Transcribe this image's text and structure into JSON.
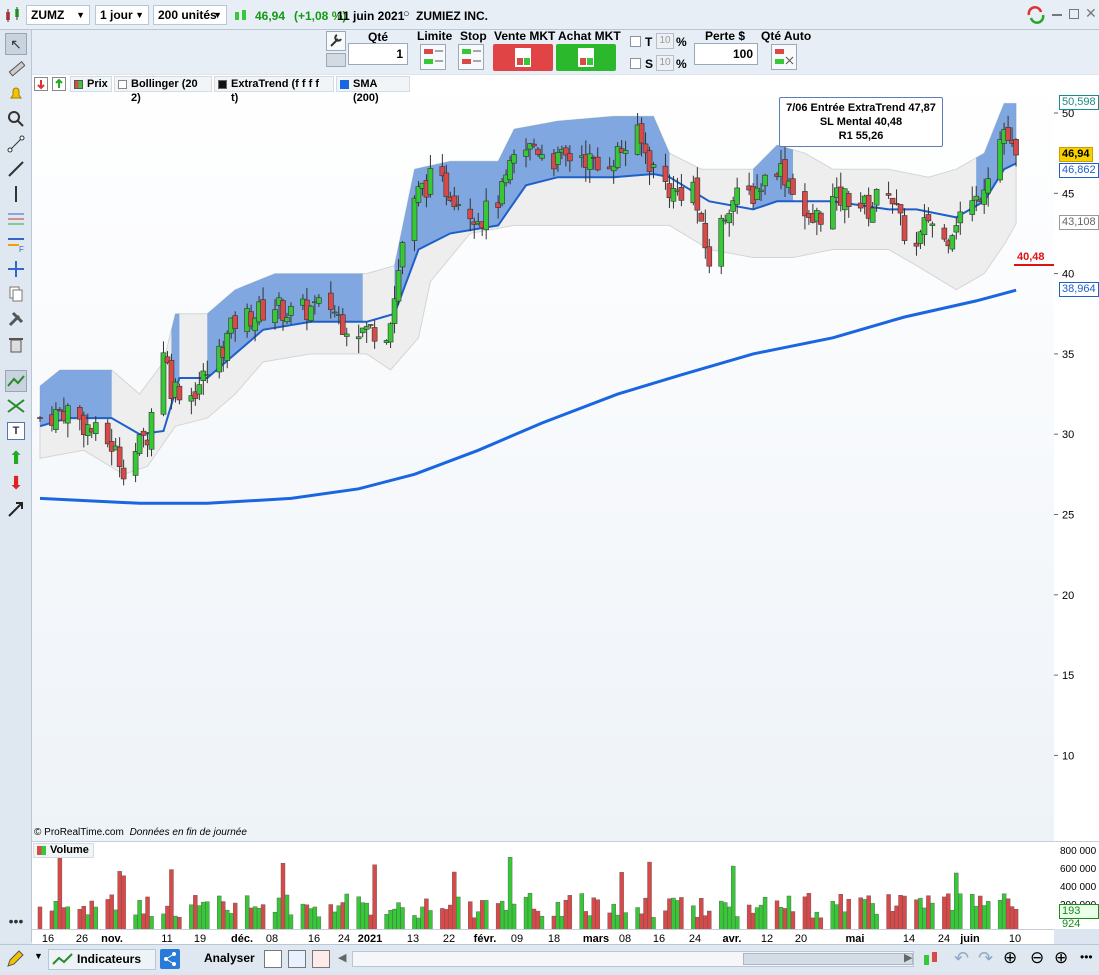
{
  "toolbar": {
    "symbol": "ZUMZ",
    "timeframe": "1 jour",
    "units": "200 unités",
    "last_price": "46,94",
    "change": "(+1,08 %)",
    "date": "11 juin 2021",
    "instrument": "ZUMIEZ INC."
  },
  "order_bar": {
    "qty_label": "Qté",
    "qty_value": "1",
    "limit_label": "Limite",
    "stop_label": "Stop",
    "sell_label": "Vente MKT",
    "buy_label": "Achat MKT",
    "t_label": "T",
    "s_label": "S",
    "pct_value": "10",
    "pct_sign": "%",
    "risk_label": "Perte $",
    "risk_value": "100",
    "auto_qty_label": "Qté Auto"
  },
  "legend": {
    "price": "Prix",
    "bollinger": "Bollinger (20 2)",
    "extratrend": "ExtraTrend (f f f f t)",
    "sma": "SMA (200)"
  },
  "annotation": {
    "line1": "7/06 Entrée ExtraTrend 47,87",
    "line2": "SL Mental 40,48",
    "line3": "R1 55,26"
  },
  "price_tags": {
    "bb_upper": "50,598",
    "last": "46,94",
    "extratrend": "46,862",
    "bb_lower": "43,108",
    "stop": "40,48",
    "sma": "38,964"
  },
  "copyright": "© ProRealTime.com",
  "data_note": "Données en fin de journée",
  "volume_panel": {
    "title": "Volume",
    "last_value": "193 924",
    "ticks": [
      "800 000",
      "600 000",
      "400 000",
      "200 000"
    ]
  },
  "bottom_bar": {
    "indicators": "Indicateurs",
    "analyze": "Analyser"
  },
  "colors": {
    "up": "#37c837",
    "down": "#d84a4a",
    "sma": "#1a66e0",
    "extratrend": "#1e5fc8",
    "bb_fill": "#eeeeee",
    "trend_fill": "#5b8fd9",
    "stop": "#dd1111"
  },
  "chart_data": {
    "type": "candlestick",
    "instrument": "ZUMZ",
    "timeframe": "daily",
    "ylim": [
      5,
      52
    ],
    "y_ticks": [
      10,
      15,
      20,
      25,
      30,
      35,
      40,
      45,
      50
    ],
    "x_tick_labels": [
      "16",
      "26",
      "nov.",
      "11",
      "19",
      "déc.",
      "08",
      "16",
      "24",
      "2021",
      "13",
      "22",
      "févr.",
      "09",
      "18",
      "mars",
      "08",
      "16",
      "24",
      "avr.",
      "12",
      "20",
      "mai",
      "14",
      "24",
      "juin",
      "10"
    ],
    "close_path": [
      [
        "2020-10-09",
        31.0
      ],
      [
        "2020-10-16",
        31.5
      ],
      [
        "2020-10-23",
        30.0
      ],
      [
        "2020-10-27",
        29.3
      ],
      [
        "2020-10-30",
        28.0
      ],
      [
        "2020-11-05",
        30.0
      ],
      [
        "2020-11-09",
        35.5
      ],
      [
        "2020-11-11",
        33.0
      ],
      [
        "2020-11-16",
        32.5
      ],
      [
        "2020-11-20",
        33.8
      ],
      [
        "2020-11-24",
        35.5
      ],
      [
        "2020-11-27",
        37.0
      ],
      [
        "2020-12-02",
        37.5
      ],
      [
        "2020-12-07",
        38.0
      ],
      [
        "2020-12-11",
        37.5
      ],
      [
        "2020-12-16",
        37.8
      ],
      [
        "2020-12-21",
        38.0
      ],
      [
        "2020-12-24",
        37.0
      ],
      [
        "2020-12-29",
        36.5
      ],
      [
        "2021-01-04",
        36.5
      ],
      [
        "2021-01-06",
        38.5
      ],
      [
        "2021-01-08",
        42.0
      ],
      [
        "2021-01-12",
        45.0
      ],
      [
        "2021-01-15",
        45.8
      ],
      [
        "2021-01-20",
        45.2
      ],
      [
        "2021-01-25",
        44.0
      ],
      [
        "2021-01-28",
        43.5
      ],
      [
        "2021-02-02",
        45.0
      ],
      [
        "2021-02-05",
        47.0
      ],
      [
        "2021-02-10",
        48.0
      ],
      [
        "2021-02-16",
        47.0
      ],
      [
        "2021-02-22",
        47.5
      ],
      [
        "2021-02-26",
        46.5
      ],
      [
        "2021-03-03",
        47.5
      ],
      [
        "2021-03-08",
        48.5
      ],
      [
        "2021-03-12",
        46.5
      ],
      [
        "2021-03-17",
        45.0
      ],
      [
        "2021-03-22",
        45.5
      ],
      [
        "2021-03-24",
        42.5
      ],
      [
        "2021-03-26",
        40.8
      ],
      [
        "2021-03-31",
        44.5
      ],
      [
        "2021-04-06",
        45.0
      ],
      [
        "2021-04-12",
        46.8
      ],
      [
        "2021-04-16",
        45.5
      ],
      [
        "2021-04-20",
        43.0
      ],
      [
        "2021-04-26",
        44.5
      ],
      [
        "2021-04-30",
        44.8
      ],
      [
        "2021-05-05",
        44.0
      ],
      [
        "2021-05-10",
        45.5
      ],
      [
        "2021-05-13",
        43.0
      ],
      [
        "2021-05-17",
        41.5
      ],
      [
        "2021-05-20",
        43.5
      ],
      [
        "2021-05-24",
        42.0
      ],
      [
        "2021-05-27",
        43.5
      ],
      [
        "2021-06-01",
        44.5
      ],
      [
        "2021-06-04",
        46.5
      ],
      [
        "2021-06-08",
        49.0
      ],
      [
        "2021-06-11",
        46.94
      ]
    ],
    "series": [
      {
        "name": "SMA (200)",
        "type": "line",
        "points": [
          [
            "2020-10-09",
            26.0
          ],
          [
            "2020-11-03",
            25.7
          ],
          [
            "2020-11-20",
            25.7
          ],
          [
            "2020-12-11",
            26.0
          ],
          [
            "2020-12-28",
            26.6
          ],
          [
            "2021-01-11",
            27.5
          ],
          [
            "2021-01-27",
            29.0
          ],
          [
            "2021-02-12",
            30.7
          ],
          [
            "2021-03-03",
            32.5
          ],
          [
            "2021-03-19",
            33.7
          ],
          [
            "2021-04-06",
            35.0
          ],
          [
            "2021-04-26",
            36.0
          ],
          [
            "2021-05-14",
            37.3
          ],
          [
            "2021-06-01",
            38.3
          ],
          [
            "2021-06-11",
            38.964
          ]
        ]
      },
      {
        "name": "Bollinger (20 2)",
        "type": "band",
        "upper": [
          [
            "2020-10-09",
            33.0
          ],
          [
            "2020-10-14",
            34.0
          ],
          [
            "2020-10-27",
            34.0
          ],
          [
            "2020-11-03",
            32.5
          ],
          [
            "2020-11-09",
            34.5
          ],
          [
            "2020-11-12",
            37.5
          ],
          [
            "2020-11-20",
            37.5
          ],
          [
            "2020-11-27",
            39.0
          ],
          [
            "2020-12-07",
            40.0
          ],
          [
            "2020-12-18",
            40.0
          ],
          [
            "2020-12-30",
            40.0
          ],
          [
            "2021-01-06",
            40.5
          ],
          [
            "2021-01-11",
            46.5
          ],
          [
            "2021-01-20",
            47.0
          ],
          [
            "2021-02-01",
            47.0
          ],
          [
            "2021-02-05",
            49.0
          ],
          [
            "2021-02-16",
            49.5
          ],
          [
            "2021-03-02",
            49.8
          ],
          [
            "2021-03-12",
            49.8
          ],
          [
            "2021-03-16",
            47.5
          ],
          [
            "2021-03-24",
            46.5
          ],
          [
            "2021-04-06",
            46.5
          ],
          [
            "2021-04-12",
            48.0
          ],
          [
            "2021-04-19",
            47.5
          ],
          [
            "2021-04-26",
            46.5
          ],
          [
            "2021-05-10",
            46.5
          ],
          [
            "2021-05-20",
            46.0
          ],
          [
            "2021-05-27",
            46.5
          ],
          [
            "2021-06-03",
            47.5
          ],
          [
            "2021-06-08",
            50.598
          ],
          [
            "2021-06-11",
            50.598
          ]
        ],
        "lower": [
          [
            "2020-10-09",
            28.5
          ],
          [
            "2020-10-20",
            29.0
          ],
          [
            "2020-10-30",
            27.5
          ],
          [
            "2020-11-05",
            28.0
          ],
          [
            "2020-11-12",
            30.5
          ],
          [
            "2020-11-20",
            31.0
          ],
          [
            "2020-11-27",
            32.5
          ],
          [
            "2020-12-04",
            34.5
          ],
          [
            "2020-12-16",
            35.0
          ],
          [
            "2020-12-30",
            35.0
          ],
          [
            "2021-01-05",
            34.0
          ],
          [
            "2021-01-12",
            36.0
          ],
          [
            "2021-01-15",
            39.5
          ],
          [
            "2021-01-25",
            42.5
          ],
          [
            "2021-02-05",
            43.0
          ],
          [
            "2021-02-16",
            43.0
          ],
          [
            "2021-03-02",
            43.0
          ],
          [
            "2021-03-16",
            43.0
          ],
          [
            "2021-03-26",
            41.5
          ],
          [
            "2021-04-06",
            41.0
          ],
          [
            "2021-04-16",
            41.0
          ],
          [
            "2021-04-26",
            41.5
          ],
          [
            "2021-05-10",
            41.5
          ],
          [
            "2021-05-17",
            40.5
          ],
          [
            "2021-05-27",
            39.0
          ],
          [
            "2021-06-03",
            40.0
          ],
          [
            "2021-06-08",
            41.8
          ],
          [
            "2021-06-11",
            43.108
          ]
        ]
      },
      {
        "name": "ExtraTrend (f f f f t)",
        "type": "line",
        "points": [
          [
            "2020-10-09",
            30.5
          ],
          [
            "2020-10-16",
            31.0
          ],
          [
            "2020-10-27",
            31.0
          ],
          [
            "2020-11-03",
            30.0
          ],
          [
            "2020-11-09",
            30.2
          ],
          [
            "2020-11-13",
            33.5
          ],
          [
            "2020-11-20",
            33.5
          ],
          [
            "2020-11-27",
            35.0
          ],
          [
            "2020-12-04",
            36.5
          ],
          [
            "2020-12-16",
            37.0
          ],
          [
            "2020-12-30",
            37.0
          ],
          [
            "2021-01-06",
            37.5
          ],
          [
            "2021-01-12",
            41.5
          ],
          [
            "2021-01-20",
            42.5
          ],
          [
            "2021-02-01",
            43.0
          ],
          [
            "2021-02-08",
            45.5
          ],
          [
            "2021-02-16",
            46.0
          ],
          [
            "2021-03-02",
            46.0
          ],
          [
            "2021-03-12",
            46.2
          ],
          [
            "2021-03-16",
            46.0
          ],
          [
            "2021-03-26",
            44.5
          ],
          [
            "2021-04-06",
            44.0
          ],
          [
            "2021-04-12",
            44.5
          ],
          [
            "2021-04-19",
            44.5
          ],
          [
            "2021-04-26",
            44.5
          ],
          [
            "2021-05-10",
            44.0
          ],
          [
            "2021-05-17",
            44.0
          ],
          [
            "2021-05-27",
            43.5
          ],
          [
            "2021-06-03",
            44.5
          ],
          [
            "2021-06-08",
            46.5
          ],
          [
            "2021-06-11",
            46.862
          ]
        ]
      },
      {
        "name": "Volume",
        "type": "bar",
        "note": "daily volumes ranging roughly 100 000 to 800 000"
      }
    ],
    "stop_level": 40.48
  }
}
